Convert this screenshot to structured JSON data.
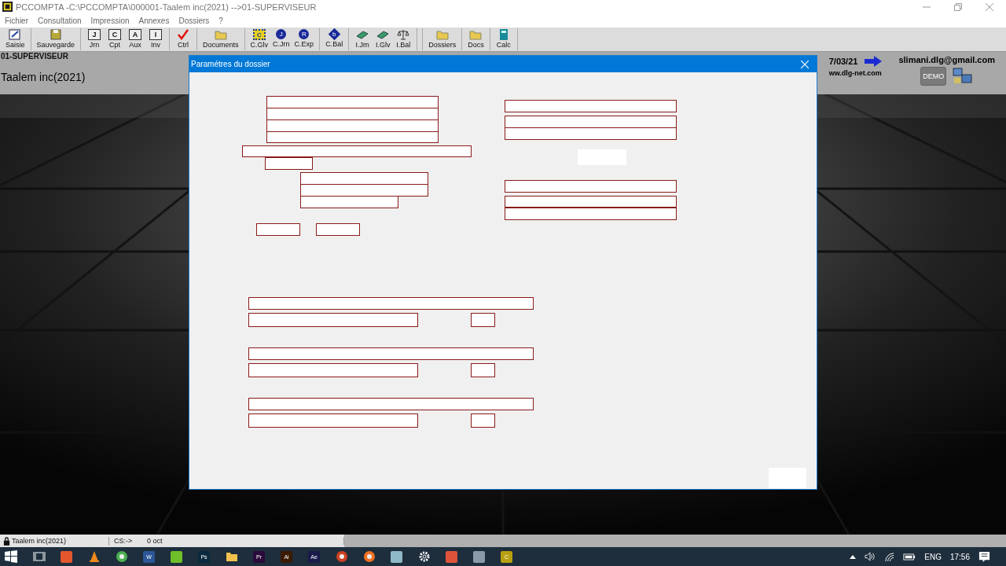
{
  "window": {
    "title": "PCCOMPTA -C:\\PCCOMPTA\\000001-Taalem inc(2021) -->01-SUPERVISEUR"
  },
  "menu": [
    "Fichier",
    "Consultation",
    "Impression",
    "Annexes",
    "Dossiers",
    "?"
  ],
  "toolbar": [
    [
      {
        "label": "Saisie",
        "kind": "pen"
      }
    ],
    [
      {
        "label": "Sauvegarde",
        "kind": "disk"
      }
    ],
    [
      {
        "label": "Jrn",
        "kind": "letterbox",
        "glyph": "J"
      },
      {
        "label": "Cpt",
        "kind": "letterbox",
        "glyph": "C"
      },
      {
        "label": "Aux",
        "kind": "letterbox",
        "glyph": "A"
      },
      {
        "label": "Inv",
        "kind": "letterbox",
        "glyph": "I"
      }
    ],
    [
      {
        "label": "Ctrl",
        "kind": "check"
      }
    ],
    [
      {
        "label": "Documents",
        "kind": "folder"
      }
    ],
    [
      {
        "label": "C.Glv",
        "kind": "grid",
        "glyph": "C"
      },
      {
        "label": "C.Jrn",
        "kind": "circle",
        "glyph": "J"
      },
      {
        "label": "C.Exp",
        "kind": "circle",
        "glyph": "R"
      }
    ],
    [
      {
        "label": "C.Bal",
        "kind": "diamond",
        "glyph": "b"
      }
    ],
    [
      {
        "label": "I.Jrn",
        "kind": "book"
      },
      {
        "label": "I.Glv",
        "kind": "book"
      },
      {
        "label": "I.Bal",
        "kind": "scale"
      }
    ],
    [
      {
        "label": "Dossiers",
        "kind": "folder"
      }
    ],
    [
      {
        "label": "Docs",
        "kind": "folder"
      }
    ],
    [
      {
        "label": "Calc",
        "kind": "calc"
      }
    ]
  ],
  "header": {
    "user": "01-SUPERVISEUR",
    "company": "Taalem inc(2021)",
    "date": "7/03/21",
    "email": "slimani.dlg@gmail.com",
    "website": "ww.dlg-net.com",
    "demo_button": "DEMO"
  },
  "dialog": {
    "title": "Paramétres du dossier"
  },
  "status_bar": {
    "company": "Taalem inc(2021)",
    "path": "CS:->",
    "size": "0 oct"
  },
  "taskbar": {
    "apps": [
      {
        "kind": "pane"
      },
      {
        "kind": "tile"
      },
      {
        "kind": "cone"
      },
      {
        "kind": "ring"
      },
      {
        "kind": "tile",
        "glyph": "W"
      },
      {
        "kind": "tile"
      },
      {
        "kind": "tile",
        "glyph": "Ps"
      },
      {
        "kind": "folder"
      },
      {
        "kind": "tile",
        "glyph": "Pr"
      },
      {
        "kind": "tile",
        "glyph": "Ai"
      },
      {
        "kind": "tile",
        "glyph": "Ae"
      },
      {
        "kind": "ring"
      },
      {
        "kind": "ring"
      },
      {
        "kind": "tile"
      },
      {
        "kind": "gear"
      },
      {
        "kind": "tile"
      },
      {
        "kind": "tile"
      },
      {
        "kind": "tile",
        "glyph": "C"
      }
    ],
    "language": "ENG",
    "time": "17:56"
  }
}
